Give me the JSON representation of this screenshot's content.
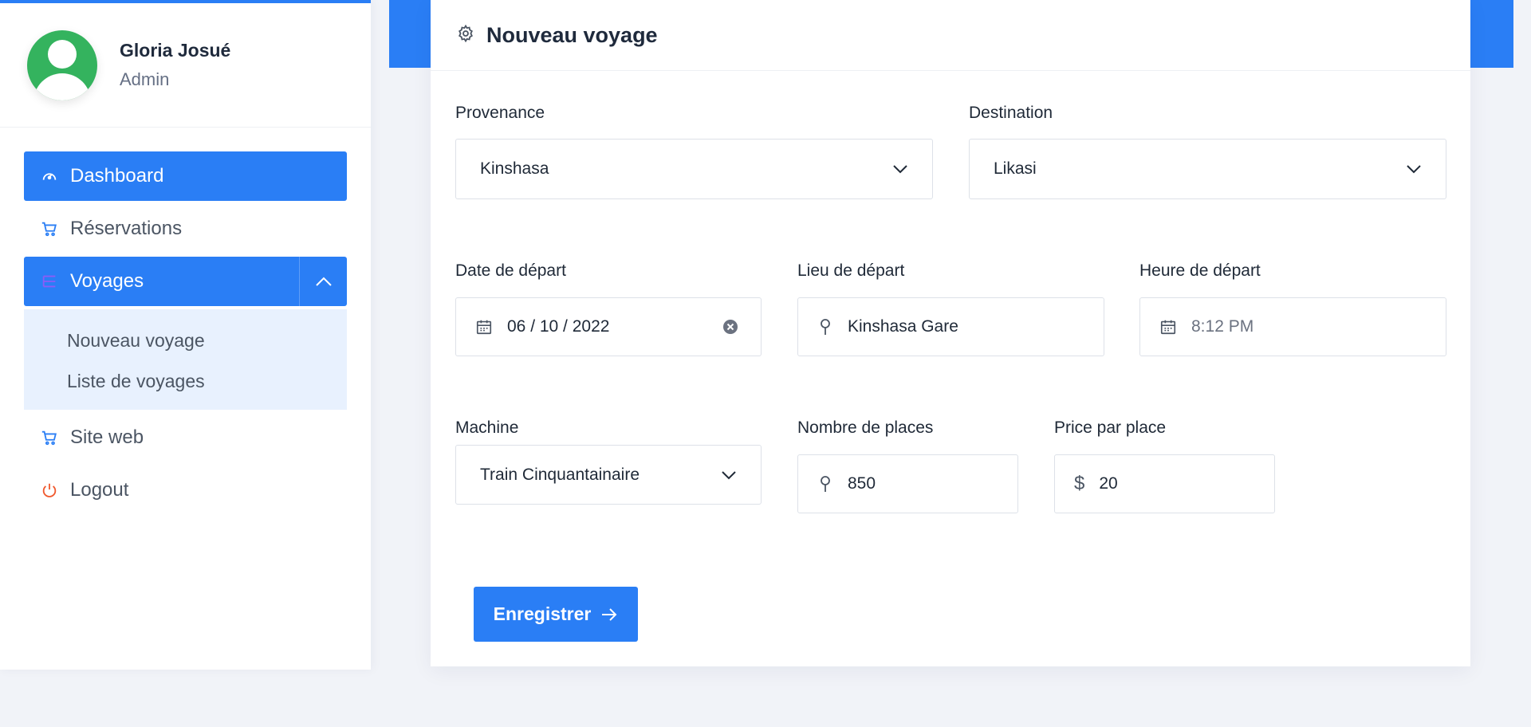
{
  "profile": {
    "name": "Gloria Josué",
    "role": "Admin"
  },
  "nav": {
    "dashboard": "Dashboard",
    "reservations": "Réservations",
    "voyages": "Voyages",
    "submenu": [
      "Nouveau voyage",
      "Liste de voyages"
    ],
    "site_web": "Site web",
    "logout": "Logout"
  },
  "form": {
    "title": "Nouveau voyage",
    "provenance": {
      "label": "Provenance",
      "value": "Kinshasa"
    },
    "destination": {
      "label": "Destination",
      "value": "Likasi"
    },
    "date_depart": {
      "label": "Date de départ",
      "value": "06 / 10 / 2022"
    },
    "lieu_depart": {
      "label": "Lieu de départ",
      "value": "Kinshasa Gare"
    },
    "heure_depart": {
      "label": "Heure de départ",
      "placeholder": "8:12 PM"
    },
    "machine": {
      "label": "Machine",
      "value": "Train Cinquantainaire"
    },
    "nombre_places": {
      "label": "Nombre de places",
      "value": "850"
    },
    "price_place": {
      "label": "Price par place",
      "value": "20"
    },
    "submit": "Enregistrer"
  },
  "colors": {
    "primary": "#2a7ef5",
    "avatar": "#34b35e",
    "logout": "#f0592e"
  }
}
